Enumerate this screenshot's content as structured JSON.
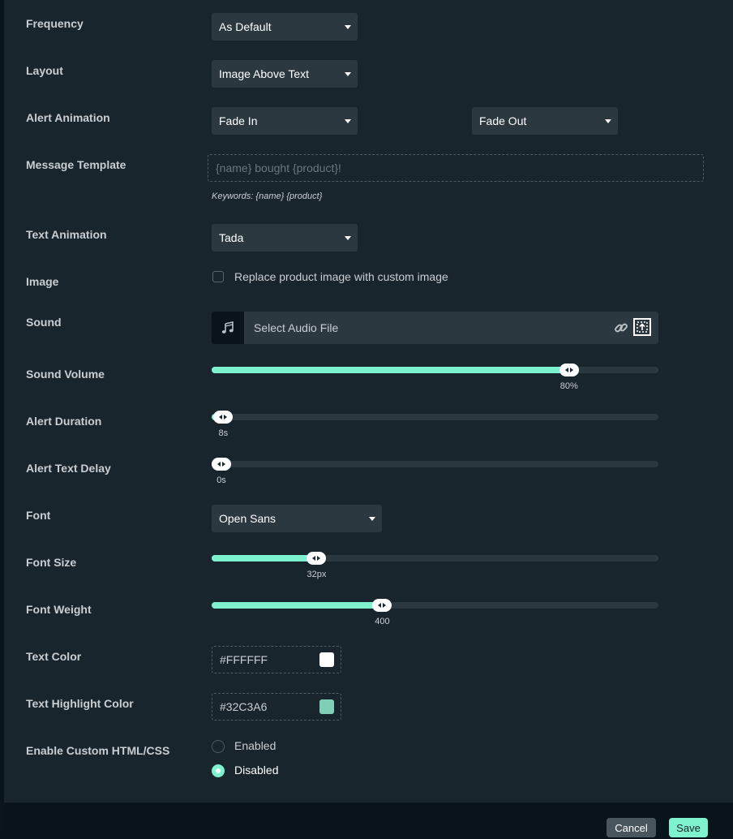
{
  "labels": {
    "frequency": "Frequency",
    "layout": "Layout",
    "alert_animation": "Alert Animation",
    "message_template": "Message Template",
    "text_animation": "Text Animation",
    "image": "Image",
    "sound": "Sound",
    "sound_volume": "Sound Volume",
    "alert_duration": "Alert Duration",
    "alert_text_delay": "Alert Text Delay",
    "font": "Font",
    "font_size": "Font Size",
    "font_weight": "Font Weight",
    "text_color": "Text Color",
    "text_highlight_color": "Text Highlight Color",
    "custom_html_css": "Enable Custom HTML/CSS"
  },
  "fields": {
    "frequency": "As Default",
    "layout": "Image Above Text",
    "animation_in": "Fade In",
    "animation_out": "Fade Out",
    "message_template_placeholder": "{name} bought {product}!",
    "message_template_value": "",
    "keywords_hint": "Keywords: {name} {product}",
    "text_animation": "Tada",
    "image_checkbox_label": "Replace product image with custom image",
    "image_checkbox_checked": false,
    "sound_placeholder": "Select Audio File",
    "font": "Open Sans",
    "text_color": "#FFFFFF",
    "text_highlight_color": "#32C3A6"
  },
  "sliders": {
    "sound_volume": {
      "fraction": 0.8,
      "label": "80%"
    },
    "alert_duration": {
      "fraction": 0.026,
      "label": "8s"
    },
    "alert_text_delay": {
      "fraction": 0.007,
      "label": "0s"
    },
    "font_size": {
      "fraction": 0.235,
      "label": "32px"
    },
    "font_weight": {
      "fraction": 0.382,
      "label": "400"
    }
  },
  "custom_html": {
    "options": [
      "Enabled",
      "Disabled"
    ],
    "selected": "Disabled"
  },
  "footer": {
    "cancel_label": "Cancel",
    "save_label": "Save"
  },
  "colors": {
    "accent": "#7EF2CF",
    "panel_bg": "#18252D",
    "control_bg": "#2B383F",
    "text_color_swatch": "#FFFFFF",
    "highlight_swatch": "#7ECFB5"
  }
}
